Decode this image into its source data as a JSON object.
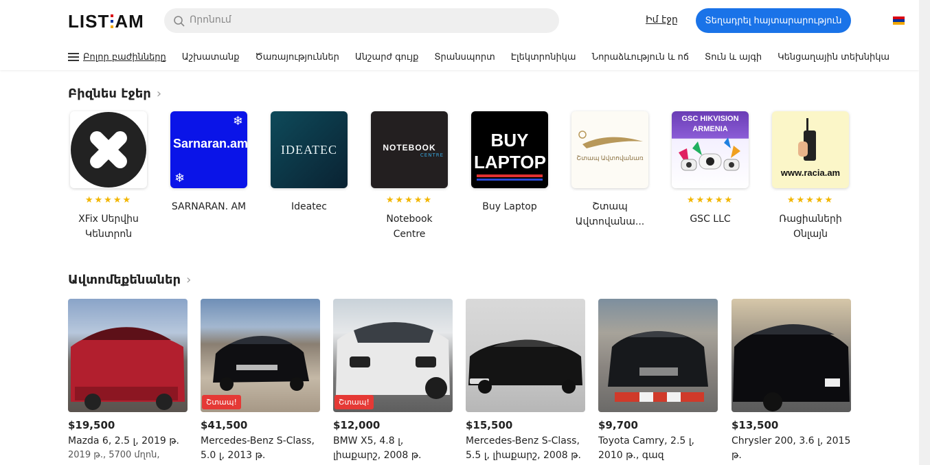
{
  "header": {
    "logo": {
      "left": "LIST",
      "right": "AM"
    },
    "search_placeholder": "Որոնում",
    "my_page": "Իմ էջը",
    "post_ad": "Տեղադրել հայտարարություն",
    "flag_colors": [
      "#d90012",
      "#0033a0",
      "#f2a800"
    ]
  },
  "nav": {
    "all_sections": "Բոլոր բաժինները",
    "items": [
      "Աշխատանք",
      "Ծառայություններ",
      "Անշարժ գույք",
      "Տրանսպորտ",
      "Էլեկտրոնիկա",
      "Նորաձևություն և ոճ",
      "Տուն և այգի",
      "Կենցաղային տեխնիկա"
    ]
  },
  "business": {
    "title": "Բիզնես էջեր",
    "pages": [
      {
        "name": "XFix Սերվիս Կենտրոն",
        "stars": "★★★★★",
        "logo_text": ""
      },
      {
        "name": "SARNARAN. AM",
        "stars": "",
        "logo_text": "Sarnaran.am"
      },
      {
        "name": "Ideatec",
        "stars": "",
        "logo_text": "IDEATEC"
      },
      {
        "name": "Notebook Centre",
        "stars": "★★★★★",
        "logo_text": "NOTEBOOK"
      },
      {
        "name": "Buy Laptop",
        "stars": "",
        "logo_text": "BUY LAPTOP"
      },
      {
        "name": "Շտապ Ավտովանա...",
        "stars": "",
        "logo_text": "Շտապ Ավտովանառ"
      },
      {
        "name": "GSC LLC",
        "stars": "★★★★★",
        "logo_text": "GSC HIKVISION ARMENIA"
      },
      {
        "name": "Ռացիաների Օնլայն",
        "stars": "★★★★★",
        "logo_text": "www.racia.am"
      }
    ]
  },
  "cars": {
    "title": "Ավտոմեքենաներ",
    "items": [
      {
        "price": "$19,500",
        "title": "Mazda 6, 2.5 լ, 2019 թ.",
        "meta": "2019 թ., 5700 մղոն,",
        "badge": ""
      },
      {
        "price": "$41,500",
        "title": "Mercedes-Benz S-Class, 5.0 լ, 2013 թ.",
        "meta": "",
        "badge": "Շտապ!"
      },
      {
        "price": "$12,000",
        "title": "BMW X5, 4.8 լ, լիաքարշ, 2008 թ.",
        "meta": "",
        "badge": "Շտապ!"
      },
      {
        "price": "$15,500",
        "title": "Mercedes-Benz S-Class, 5.5 լ, լիաքարշ, 2008 թ.",
        "meta": "",
        "badge": ""
      },
      {
        "price": "$9,700",
        "title": "Toyota Camry, 2.5 լ, 2010 թ., գազ",
        "meta": "",
        "badge": ""
      },
      {
        "price": "$13,500",
        "title": "Chrysler 200, 3.6 լ, 2015 թ.",
        "meta": "",
        "badge": ""
      }
    ]
  }
}
